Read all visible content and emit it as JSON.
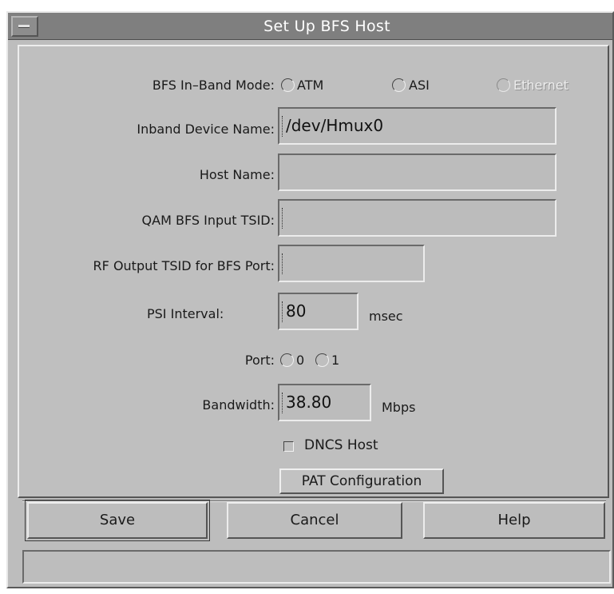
{
  "window": {
    "title": "Set Up BFS Host"
  },
  "form": {
    "inband_mode": {
      "label": "BFS In–Band Mode:",
      "options": [
        {
          "label": "ATM",
          "enabled": true,
          "selected": false
        },
        {
          "label": "ASI",
          "enabled": true,
          "selected": false
        },
        {
          "label": "Ethernet",
          "enabled": false,
          "selected": false
        }
      ]
    },
    "device_name": {
      "label": "Inband Device Name:",
      "value": "/dev/Hmux0"
    },
    "host_name": {
      "label": "Host Name:",
      "value": ""
    },
    "qam_tsid": {
      "label": "QAM BFS Input TSID:",
      "value": ""
    },
    "rf_tsid": {
      "label": "RF Output TSID for BFS Port:",
      "value": ""
    },
    "psi_interval": {
      "label": "PSI Interval:",
      "value": "80",
      "unit": "msec"
    },
    "port": {
      "label": "Port:",
      "options": [
        {
          "label": "0",
          "selected": false
        },
        {
          "label": "1",
          "selected": false
        }
      ]
    },
    "bandwidth": {
      "label": "Bandwidth:",
      "value": "38.80",
      "unit": "Mbps"
    },
    "dncs_host": {
      "label": "DNCS Host",
      "checked": false
    },
    "pat_button": "PAT Configuration"
  },
  "buttons": {
    "save": "Save",
    "cancel": "Cancel",
    "help": "Help"
  },
  "status_bar": {
    "text": ""
  }
}
